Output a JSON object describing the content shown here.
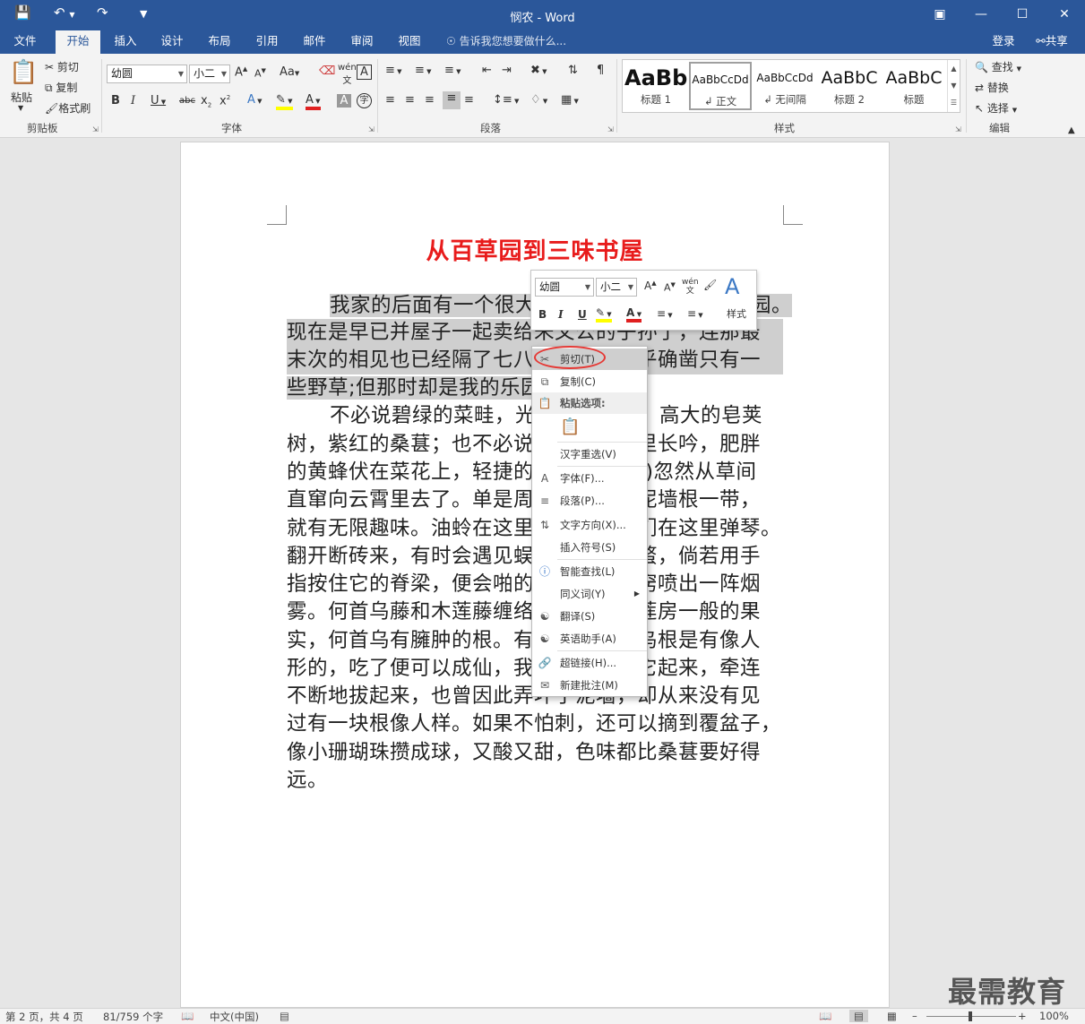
{
  "window": {
    "title": "悯农 - Word",
    "account": "登录",
    "share": "共享"
  },
  "tabs": [
    "文件",
    "开始",
    "插入",
    "设计",
    "布局",
    "引用",
    "邮件",
    "审阅",
    "视图"
  ],
  "tell_me": "告诉我您想要做什么...",
  "clipboard": {
    "paste": "粘贴",
    "cut": "剪切",
    "copy": "复制",
    "format_painter": "格式刷",
    "label": "剪贴板"
  },
  "font": {
    "name": "幼圆",
    "size": "小二",
    "label": "字体"
  },
  "paragraph": {
    "label": "段落"
  },
  "styles": {
    "label": "样式",
    "items": [
      {
        "preview": "AaBb",
        "name": "标题 1"
      },
      {
        "preview": "AaBbCcDd",
        "name": "正文"
      },
      {
        "preview": "AaBbCcDd",
        "name": "无间隔"
      },
      {
        "preview": "AaBbC",
        "name": "标题 2"
      },
      {
        "preview": "AaBbC",
        "name": "标题"
      }
    ]
  },
  "editing": {
    "find": "查找",
    "replace": "替换",
    "select": "选择",
    "label": "编辑"
  },
  "document": {
    "title": "从百草园到三味书屋",
    "lines": [
      "我家的后面有一个很大",
      "现在是早已并屋子一起卖给朱文公的子孙了，连那最",
      "末次的相见也已经隔了七八年，其中似乎确凿只有一",
      "些野草;但那时却是我的乐园。",
      "不必说碧绿的菜畦，光滑的石井栏，高大的皂荚",
      "树，紫红的桑葚；也不必说鸣蝉在树叶里长吟，肥胖",
      "的黄蜂伏在菜花上，轻捷的叫天子(云雀)忽然从草间",
      "直窜向云霄里去了。单是周围的短短的泥墙根一带，",
      "就有无限趣味。油蛉在这里低唱，蟋蟀们在这里弹琴。",
      "翻开断砖来，有时会遇见蜈蚣；还有斑蝥，倘若用手",
      "指按住它的脊梁，便会啪的一声，从后窍喷出一阵烟",
      "雾。何首乌藤和木莲藤缠络着，木莲有莲房一般的果",
      "实，何首乌有臃肿的根。有人说，何首乌根是有像人",
      "形的，吃了便可以成仙，我于是常常拔它起来，牵连",
      "不断地拔起来，也曾因此弄坏了泥墙，却从来没有见",
      "过有一块根像人样。如果不怕刺，还可以摘到覆盆子，",
      "像小珊瑚珠攒成球，又酸又甜，色味都比桑葚要好得",
      "远。"
    ],
    "line1_tail": "园。"
  },
  "mini_toolbar": {
    "font": "幼圆",
    "size": "小二",
    "styles": "样式"
  },
  "context_menu": {
    "items": [
      "剪切(T)",
      "复制(C)",
      "粘贴选项:",
      "汉字重选(V)",
      "字体(F)...",
      "段落(P)...",
      "文字方向(X)...",
      "插入符号(S)",
      "智能查找(L)",
      "同义词(Y)",
      "翻译(S)",
      "英语助手(A)",
      "超链接(H)...",
      "新建批注(M)"
    ]
  },
  "status": {
    "page": "第 2 页，共 4 页",
    "words": "81/759 个字",
    "lang": "中文(中国)",
    "zoom": "100%"
  },
  "watermark": "最需教育"
}
